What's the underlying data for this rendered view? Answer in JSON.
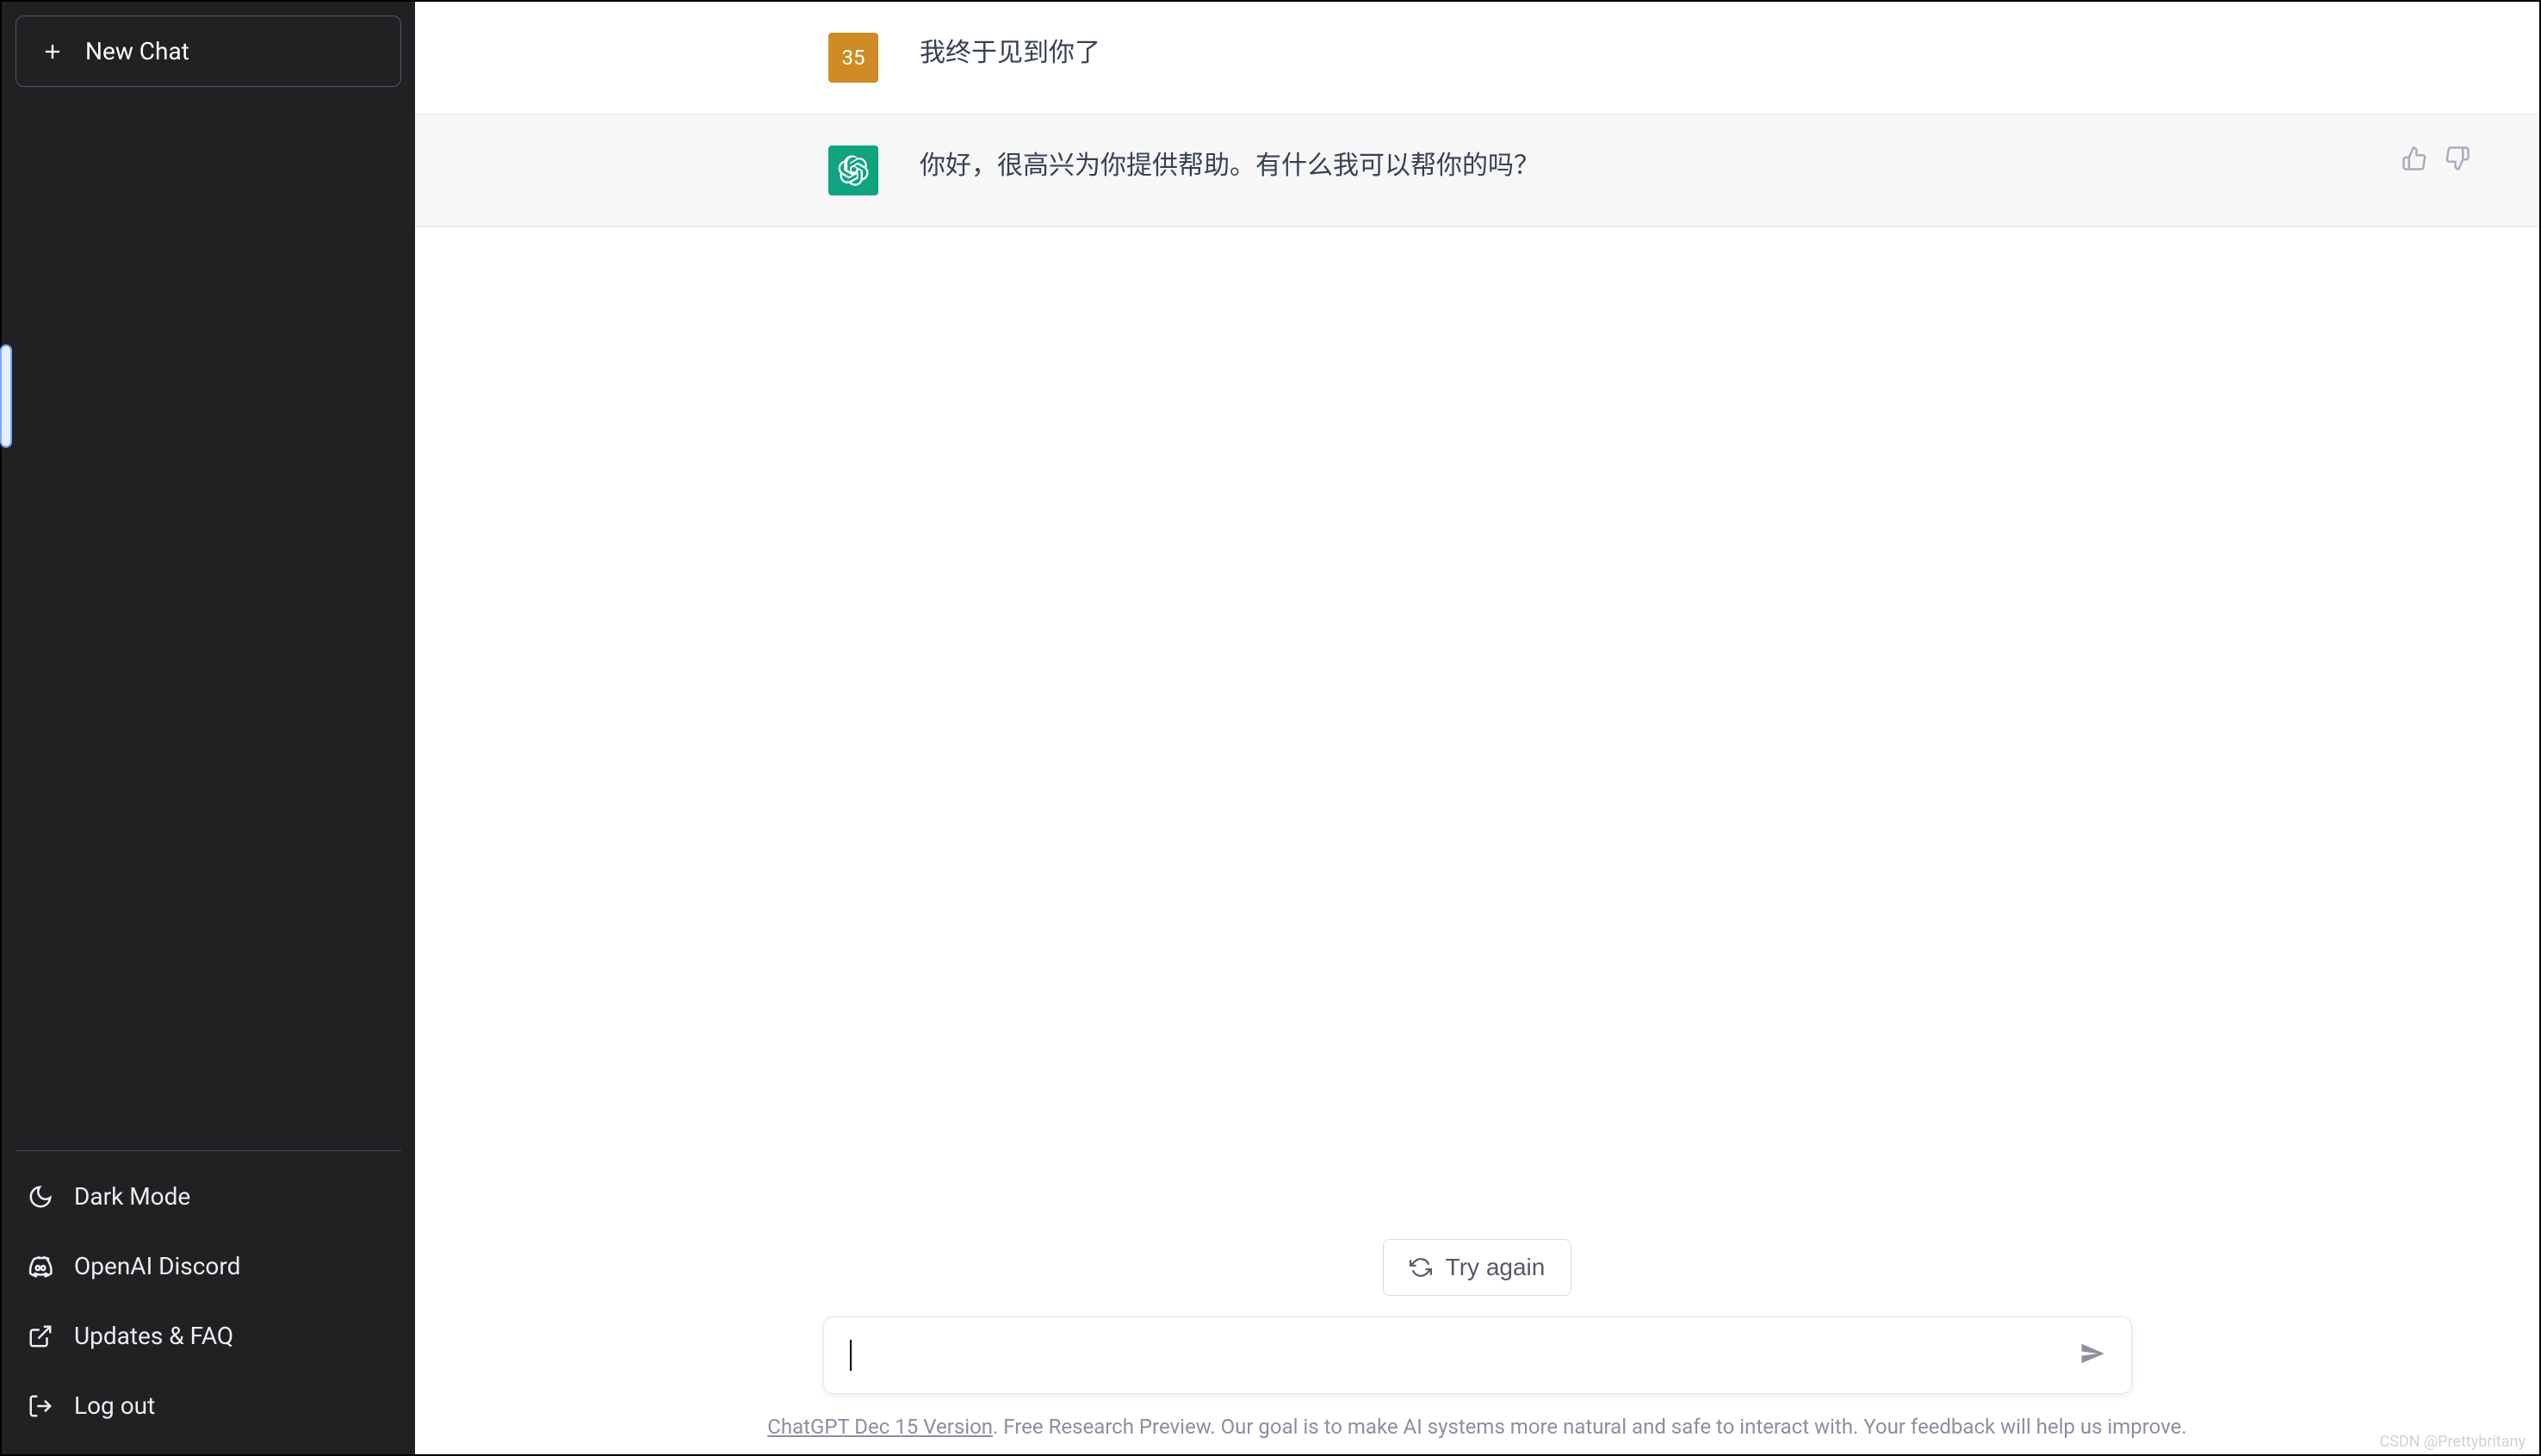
{
  "sidebar": {
    "new_chat_label": "New Chat",
    "footer_items": [
      {
        "id": "dark-mode",
        "label": "Dark Mode"
      },
      {
        "id": "discord",
        "label": "OpenAI Discord"
      },
      {
        "id": "updates-faq",
        "label": "Updates & FAQ"
      },
      {
        "id": "log-out",
        "label": "Log out"
      }
    ]
  },
  "conversation": {
    "user_avatar_text": "35",
    "messages": [
      {
        "role": "user",
        "text": "我终于见到你了"
      },
      {
        "role": "assistant",
        "text": "你好，很高兴为你提供帮助。有什么我可以帮你的吗？"
      }
    ]
  },
  "controls": {
    "try_again_label": "Try again",
    "input_value": "",
    "input_placeholder": ""
  },
  "footer": {
    "version_link_text": "ChatGPT Dec 15 Version",
    "note_suffix": ". Free Research Preview. Our goal is to make AI systems more natural and safe to interact with. Your feedback will help us improve."
  },
  "watermark": "CSDN @Prettybritany"
}
